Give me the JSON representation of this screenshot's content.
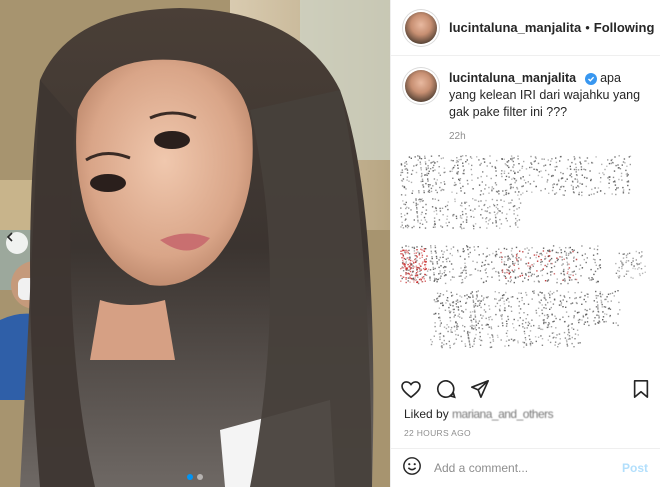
{
  "post": {
    "username": "lucintaluna_manjalita",
    "follow_status": "Following",
    "separator": "•",
    "caption_username": "lucintaluna_manjalita",
    "caption_text": "apa yang kelean IRI dari wajahku yang gak pake filter ini ???",
    "caption_age": "22h",
    "liked_by_prefix": "Liked by",
    "liked_by_users": "mariana_and_others",
    "posted_ago": "22 HOURS AGO",
    "comment_placeholder": "Add a comment...",
    "post_label": "Post",
    "carousel_index": 1,
    "carousel_count": 2
  },
  "icons": {
    "heart": "heart-icon",
    "comment": "comment-icon",
    "share": "share-icon",
    "bookmark": "bookmark-icon",
    "emoji": "emoji-icon",
    "verified": "verified-badge-icon",
    "carousel_prev": "chevron-left-icon"
  },
  "colors": {
    "verified_blue": "#3897f0",
    "post_button": "#b2dffc",
    "muted_text": "#8e8e8e"
  }
}
